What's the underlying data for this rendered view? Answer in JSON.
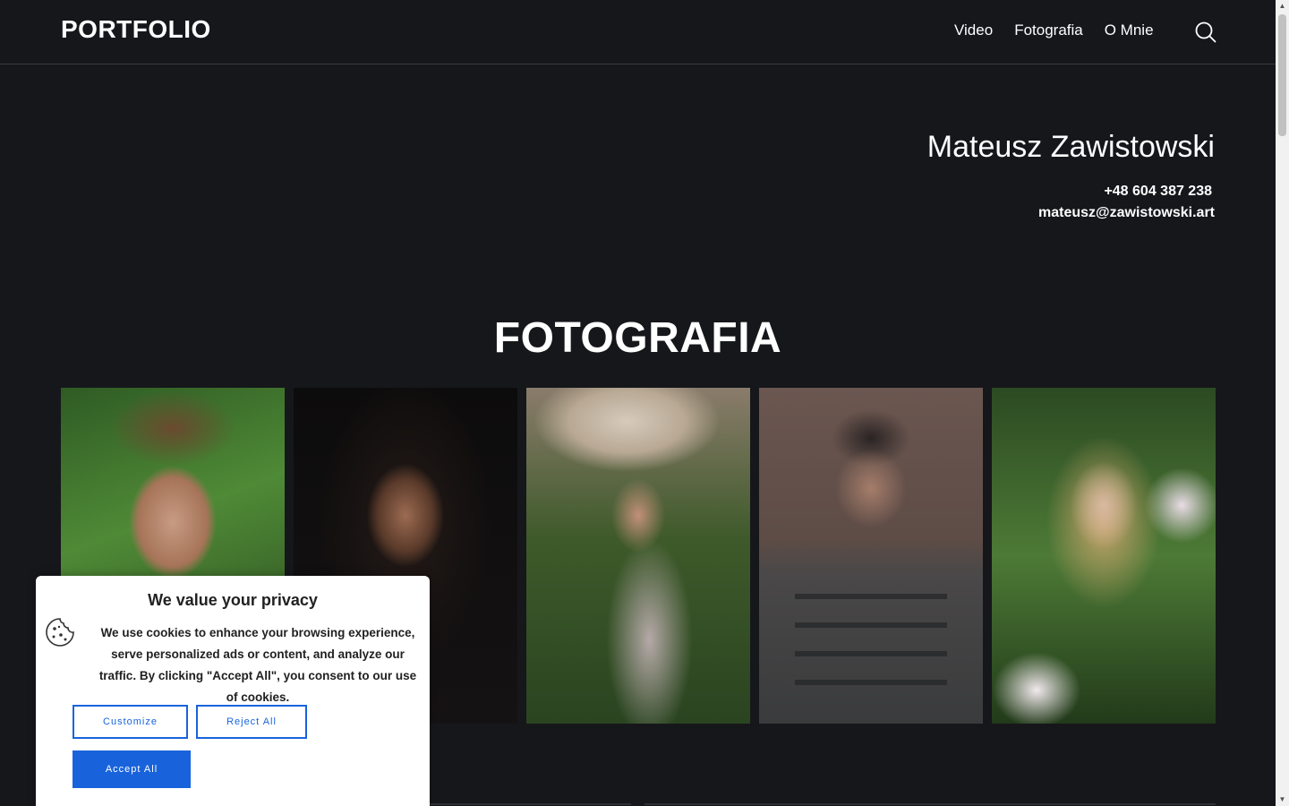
{
  "header": {
    "logo": "PORTFOLIO",
    "nav": [
      "Video",
      "Fotografia",
      "O Mnie"
    ],
    "search_icon": "search-icon"
  },
  "contact": {
    "name": "Mateusz Zawistowski",
    "phone": "+48 604 387 238",
    "email": "mateusz@zawistowski.art"
  },
  "section": {
    "title": "FOTOGRAFIA"
  },
  "cookie": {
    "title": "We value your privacy",
    "icon": "cookie-icon",
    "text": "We use cookies to enhance your browsing experience, serve personalized ads or content, and analyze our traffic. By clicking \"Accept All\", you consent to our use of cookies.",
    "customize_label": "Customize",
    "reject_label": "Reject All",
    "accept_label": "Accept All"
  },
  "colors": {
    "background": "#16171b",
    "accent": "#1863dc",
    "text": "#ffffff"
  }
}
